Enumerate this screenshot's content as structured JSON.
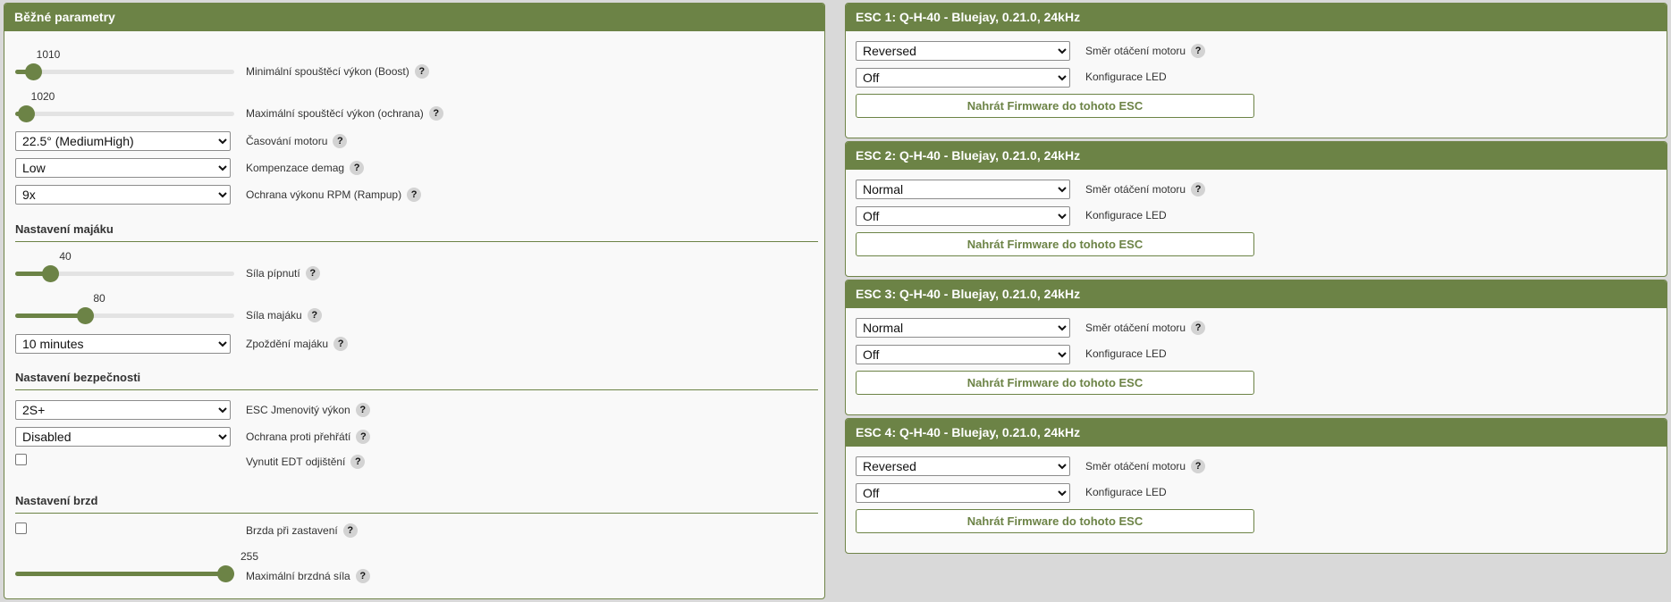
{
  "common": {
    "title": "Běžné parametry",
    "min_boost": {
      "value_label": "1010",
      "fraction": 0.08,
      "label": "Minimální spouštěcí výkon (Boost)"
    },
    "max_boost": {
      "value_label": "1020",
      "fraction": 0.05,
      "label": "Maximální spouštěcí výkon (ochrana)"
    },
    "timing": {
      "selected": "22.5° (MediumHigh)",
      "label": "Časování motoru"
    },
    "demag": {
      "selected": "Low",
      "label": "Kompenzace demag"
    },
    "rampup": {
      "selected": "9x",
      "label": "Ochrana výkonu RPM (Rampup)"
    },
    "beacon_section": "Nastavení majáku",
    "beep_strength": {
      "value_label": "40",
      "fraction": 0.16,
      "label": "Síla pípnutí"
    },
    "beacon_strength": {
      "value_label": "80",
      "fraction": 0.32,
      "label": "Síla majáku"
    },
    "beacon_delay": {
      "selected": "10 minutes",
      "label": "Zpoždění majáku"
    },
    "safety_section": "Nastavení bezpečnosti",
    "power_rating": {
      "selected": "2S+",
      "label": "ESC Jmenovitý výkon"
    },
    "temp_protection": {
      "selected": "Disabled",
      "label": "Ochrana proti přehřátí"
    },
    "edt_arming": {
      "checked": false,
      "label": "Vynutit EDT odjištění"
    },
    "brake_section": "Nastavení brzd",
    "brake_on_stop": {
      "checked": false,
      "label": "Brzda při zastavení"
    },
    "max_brake": {
      "value_label": "255",
      "fraction": 1.0,
      "label": "Maximální brzdná síla"
    }
  },
  "help_glyph": "?",
  "esc_common": {
    "direction_label": "Směr otáčení motoru",
    "led_label": "Konfigurace LED",
    "flash_label": "Nahrát Firmware do tohoto ESC"
  },
  "escs": [
    {
      "title": "ESC 1: Q-H-40 - Bluejay, 0.21.0, 24kHz",
      "direction": "Reversed",
      "led": "Off"
    },
    {
      "title": "ESC 2: Q-H-40 - Bluejay, 0.21.0, 24kHz",
      "direction": "Normal",
      "led": "Off"
    },
    {
      "title": "ESC 3: Q-H-40 - Bluejay, 0.21.0, 24kHz",
      "direction": "Normal",
      "led": "Off"
    },
    {
      "title": "ESC 4: Q-H-40 - Bluejay, 0.21.0, 24kHz",
      "direction": "Reversed",
      "led": "Off"
    }
  ],
  "colors": {
    "accent": "#6c8346",
    "background": "#d9d9d9",
    "panel": "#f9f9f9"
  }
}
